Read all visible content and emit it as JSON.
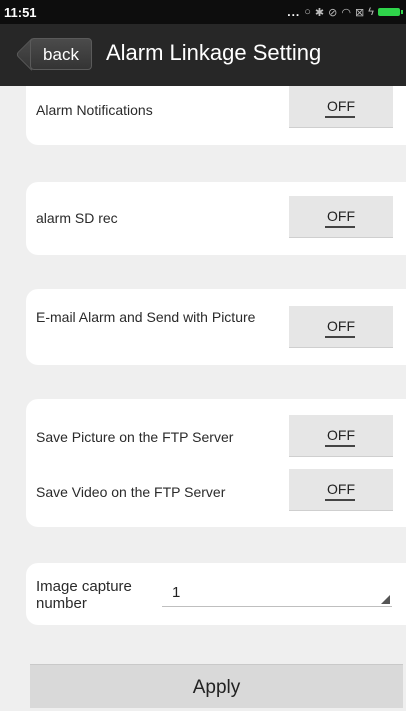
{
  "status_bar": {
    "time": "11:51",
    "dots": "...",
    "icons": [
      "circle-icon",
      "bluetooth-icon",
      "alarm-off-icon",
      "wifi-icon",
      "sim-icon",
      "charging-icon",
      "battery-icon"
    ],
    "battery_color": "#2fd54b"
  },
  "header": {
    "back_label": "back",
    "title": "Alarm Linkage Setting"
  },
  "settings": {
    "alarm_notifications": {
      "label": "Alarm Notifications",
      "value": "OFF"
    },
    "alarm_sd_rec": {
      "label": "alarm SD rec",
      "value": "OFF"
    },
    "email_alarm": {
      "label": "E-mail Alarm and Send with Picture",
      "value": "OFF"
    },
    "ftp_picture": {
      "label": "Save Picture on the FTP Server",
      "value": "OFF"
    },
    "ftp_video": {
      "label": "Save Video on the FTP Server",
      "value": "OFF"
    },
    "image_capture": {
      "label": "Image capture number",
      "value": "1"
    }
  },
  "apply_label": "Apply",
  "colors": {
    "title_bar": "#272727",
    "background": "#efefef",
    "toggle": "#e6e6e6",
    "apply": "#d9d9d9"
  }
}
